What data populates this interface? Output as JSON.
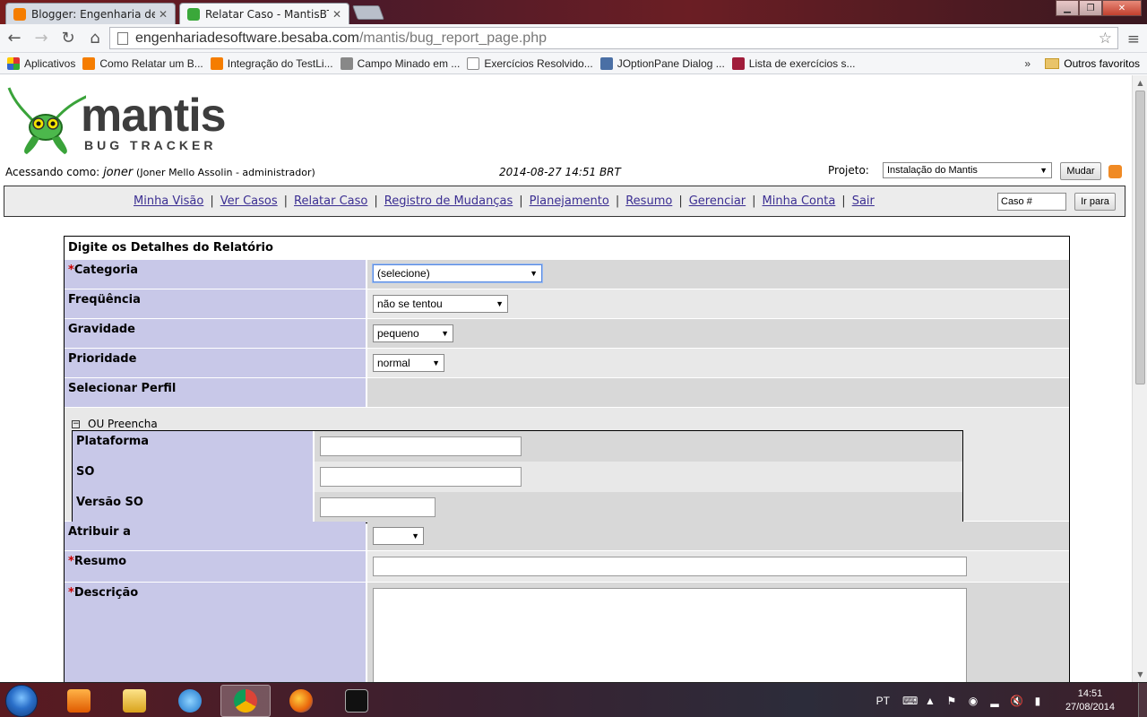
{
  "browser": {
    "tabs": [
      {
        "title": "Blogger: Engenharia de So",
        "color": "#f57d00"
      },
      {
        "title": "Relatar Caso - MantisBT",
        "color": "#3aa83a"
      }
    ],
    "url_host": "engenhariadesoftware.besaba.com",
    "url_path": "/mantis/bug_report_page.php",
    "bookmarks": [
      {
        "label": "Aplicativos",
        "color": "#d33"
      },
      {
        "label": "Como Relatar um B...",
        "color": "#f57d00"
      },
      {
        "label": "Integração do TestLi...",
        "color": "#f57d00"
      },
      {
        "label": "Campo Minado em ...",
        "color": "#888"
      },
      {
        "label": "Exercícios Resolvido...",
        "color": "#ddd"
      },
      {
        "label": "JOptionPane Dialog ...",
        "color": "#4a6fa5"
      },
      {
        "label": "Lista de exercícios s...",
        "color": "#a01c3a"
      }
    ],
    "bookmarks_more": "»",
    "other_bookmarks": "Outros favoritos"
  },
  "header": {
    "logo_word": "mantis",
    "logo_sub": "BUG TRACKER",
    "access_label": "Acessando como:",
    "username": "joner",
    "user_detail": "(Joner Mello Assolin - administrador)",
    "datetime": "2014-08-27 14:51 BRT",
    "project_label": "Projeto:",
    "project_value": "Instalação do Mantis",
    "change_button": "Mudar"
  },
  "menu": {
    "items": [
      "Minha Visão",
      "Ver Casos",
      "Relatar Caso",
      "Registro de Mudanças",
      "Planejamento",
      "Resumo",
      "Gerenciar",
      "Minha Conta",
      "Sair"
    ],
    "sep": "|",
    "case_placeholder": "Caso #",
    "go_button": "Ir para"
  },
  "form": {
    "title": "Digite os Detalhes do Relatório",
    "required_mark": "*",
    "category_label": "Categoria",
    "category_value": "(selecione)",
    "frequency_label": "Freqüência",
    "frequency_value": "não se tentou",
    "severity_label": "Gravidade",
    "severity_value": "pequeno",
    "priority_label": "Prioridade",
    "priority_value": "normal",
    "profile_label": "Selecionar Perfil",
    "or_fill": "OU Preencha",
    "platform_label": "Plataforma",
    "os_label": "SO",
    "os_version_label": "Versão SO",
    "assign_label": "Atribuir a",
    "summary_label": "Resumo",
    "description_label": "Descrição"
  },
  "taskbar": {
    "lang": "PT",
    "time": "14:51",
    "date": "27/08/2014"
  }
}
